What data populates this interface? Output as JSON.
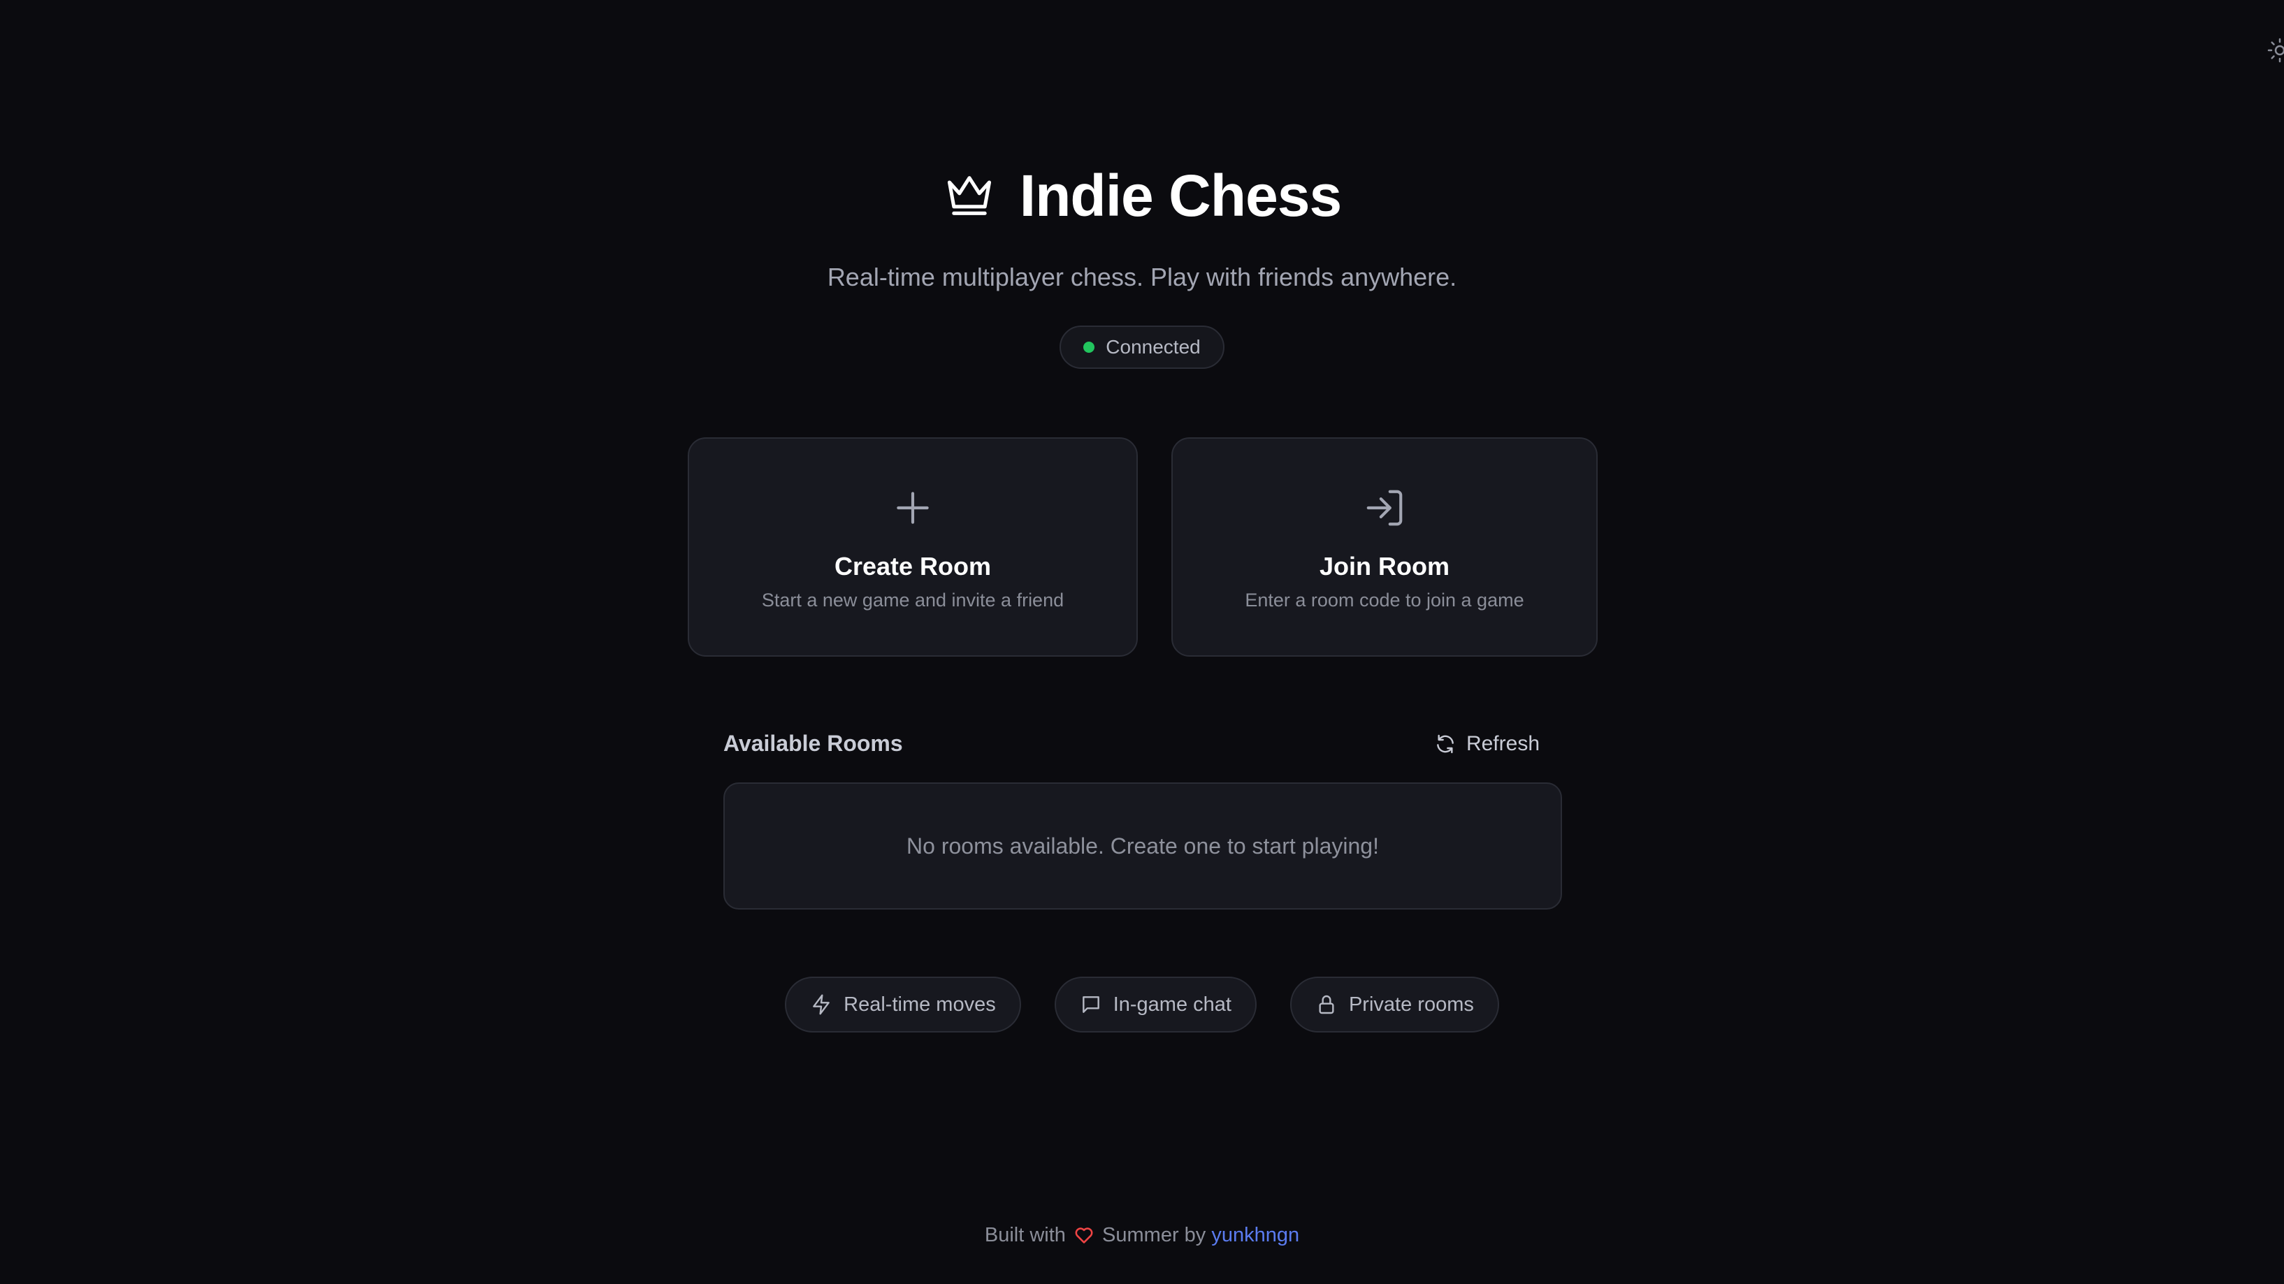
{
  "app": {
    "title": "Indie Chess",
    "subtitle": "Real-time multiplayer chess. Play with friends anywhere."
  },
  "status": {
    "label": "Connected",
    "color": "#22c55e"
  },
  "actions": {
    "create": {
      "title": "Create Room",
      "description": "Start a new game and invite a friend",
      "icon": "plus-icon"
    },
    "join": {
      "title": "Join Room",
      "description": "Enter a room code to join a game",
      "icon": "log-in-icon"
    }
  },
  "rooms": {
    "title": "Available Rooms",
    "refresh_label": "Refresh",
    "empty_message": "No rooms available. Create one to start playing!"
  },
  "features": [
    {
      "label": "Real-time moves",
      "icon": "lightning-icon"
    },
    {
      "label": "In-game chat",
      "icon": "chat-bubble-icon"
    },
    {
      "label": "Private rooms",
      "icon": "lock-icon"
    }
  ],
  "footer": {
    "prefix": "Built with",
    "middle": "Summer by",
    "author": "yunkhngn",
    "heart_color": "#ef4444",
    "link_color": "#5b7cf0"
  }
}
